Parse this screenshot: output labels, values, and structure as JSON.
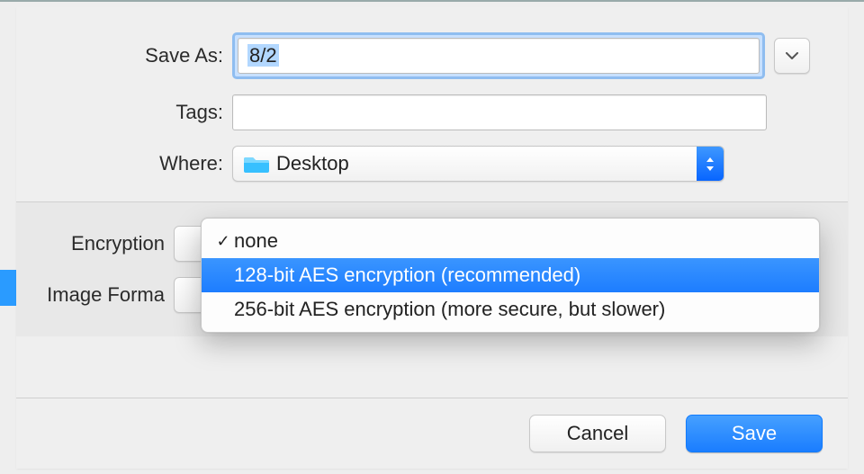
{
  "labels": {
    "save_as": "Save As:",
    "tags": "Tags:",
    "where": "Where:",
    "encryption": "Encryption",
    "image_format": "Image Forma"
  },
  "save_as_value": "8/2",
  "tags_value": "",
  "where_value": "Desktop",
  "encryption_menu": {
    "items": [
      {
        "label": "none",
        "checked": true
      },
      {
        "label": "128-bit AES encryption (recommended)",
        "checked": false
      },
      {
        "label": "256-bit AES encryption (more secure, but slower)",
        "checked": false
      }
    ],
    "highlighted_index": 1
  },
  "buttons": {
    "cancel": "Cancel",
    "save": "Save"
  },
  "icons": {
    "folder": "folder-icon",
    "chevron_down": "chevron-down-icon",
    "stepper": "stepper-updown-icon",
    "checkmark": "✓"
  }
}
